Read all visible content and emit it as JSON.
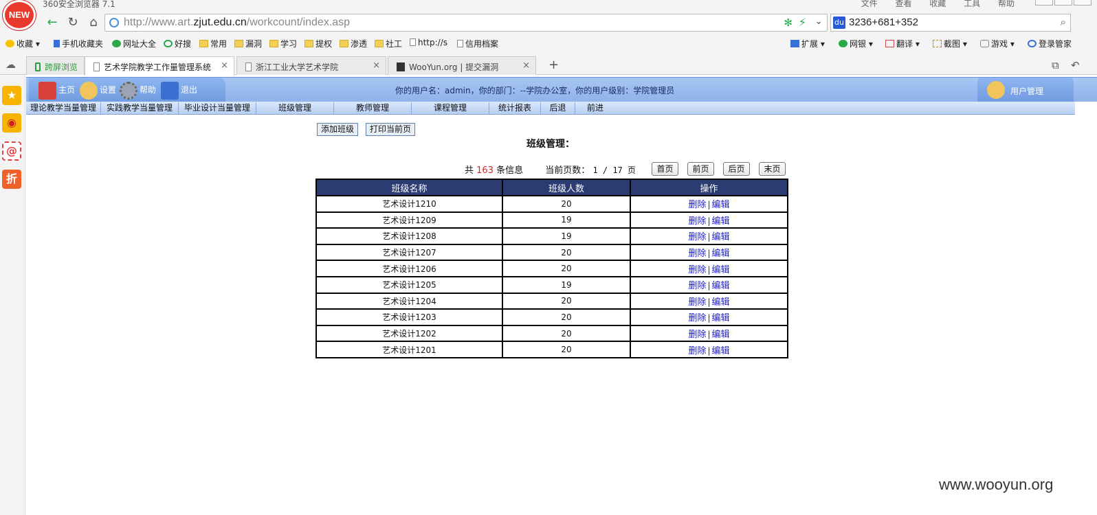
{
  "browser": {
    "app_title": "360安全浏览器 7.1",
    "new_badge": "NEW",
    "menu": [
      "文件",
      "查看",
      "收藏",
      "工具",
      "帮助"
    ],
    "address_host_prefix": "http://www.art.",
    "address_host_bold": "zjut.edu.cn",
    "address_path": "/workcount/index.asp",
    "search_value": "3236+681+352",
    "bookmarks": [
      "收藏",
      "手机收藏夹",
      "网址大全",
      "好搜",
      "常用",
      "漏洞",
      "学习",
      "提权",
      "渗透",
      "社工",
      "http://s",
      "信用档案"
    ],
    "toolbar_right": [
      "扩展",
      "网银",
      "翻译",
      "截图",
      "游戏",
      "登录管家"
    ],
    "tabs": [
      {
        "label": "跨屏浏览"
      },
      {
        "label": "艺术学院教学工作量管理系统"
      },
      {
        "label": "浙江工业大学艺术学院"
      },
      {
        "label": "WooYun.org | 提交漏洞"
      }
    ]
  },
  "sidebar": {
    "icons": [
      "star-icon",
      "weibo-icon",
      "mail-icon",
      "discount-icon"
    ],
    "discount_label": "折",
    "mail_label": "@"
  },
  "header": {
    "nav": [
      "主页",
      "设置",
      "帮助",
      "退出"
    ],
    "user_info": "你的用户名：admin，你的部门：--学院办公室，你的用户级别：学院管理员",
    "user_mgmt": "用户管理"
  },
  "menubar": [
    "理论教学当量管理",
    "实践教学当量管理",
    "毕业设计当量管理",
    "班级管理",
    "教师管理",
    "课程管理",
    "统计报表",
    "后退",
    "前进"
  ],
  "actions": {
    "add_class": "添加班级",
    "print_page": "打印当前页"
  },
  "page_title": "班级管理：",
  "pager": {
    "total_prefix": "共",
    "total": "163",
    "total_suffix": "条信息",
    "current_label": "当前页数：",
    "page_value": "1 / 17 页",
    "first": "首页",
    "prev": "前页",
    "next": "后页",
    "last": "末页"
  },
  "table": {
    "headers": [
      "班级名称",
      "班级人数",
      "操作"
    ],
    "delete_label": "删除",
    "edit_label": "编辑",
    "separator": "|",
    "rows": [
      {
        "name": "艺术设计1210",
        "count": "20"
      },
      {
        "name": "艺术设计1209",
        "count": "19"
      },
      {
        "name": "艺术设计1208",
        "count": "19"
      },
      {
        "name": "艺术设计1207",
        "count": "20"
      },
      {
        "name": "艺术设计1206",
        "count": "20"
      },
      {
        "name": "艺术设计1205",
        "count": "19"
      },
      {
        "name": "艺术设计1204",
        "count": "20"
      },
      {
        "name": "艺术设计1203",
        "count": "20"
      },
      {
        "name": "艺术设计1202",
        "count": "20"
      },
      {
        "name": "艺术设计1201",
        "count": "20"
      }
    ]
  },
  "watermark": "www.wooyun.org"
}
